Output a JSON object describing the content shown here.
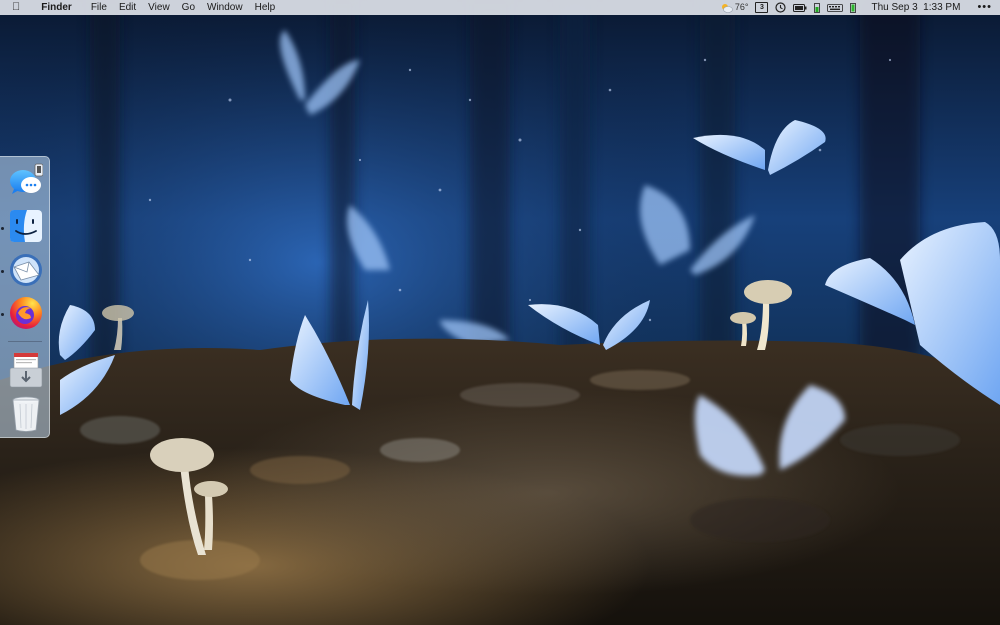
{
  "menubar": {
    "apple_icon": "apple-logo-icon",
    "app_name": "Finder",
    "menus": [
      "File",
      "Edit",
      "View",
      "Go",
      "Window",
      "Help"
    ],
    "weather": {
      "icon": "partly-cloudy-icon",
      "temperature": "76°"
    },
    "calendar_badge": "3",
    "clock": "Thu Sep 3  1:33 PM",
    "status_icons": [
      "weather-icon",
      "calendar-icon",
      "time-machine-icon",
      "battery-icon",
      "battery-level-icon",
      "keyboard-icon",
      "battery-green-icon",
      "more-icon"
    ]
  },
  "dock": {
    "items": [
      {
        "name": "messages",
        "icon": "messages-icon",
        "running": false
      },
      {
        "name": "finder",
        "icon": "finder-icon",
        "running": true
      },
      {
        "name": "mail",
        "icon": "mail-icon",
        "running": true
      },
      {
        "name": "firefox",
        "icon": "firefox-icon",
        "running": true
      },
      {
        "name": "downloads",
        "icon": "downloads-stack-icon",
        "running": false
      },
      {
        "name": "trash",
        "icon": "trash-icon",
        "running": false
      }
    ]
  },
  "wallpaper": {
    "description_icon": "wallpaper-blue-butterflies-mushrooms",
    "colors": {
      "sky_top": "#0d1f3c",
      "sky_mid": "#1d4c8a",
      "ground_dark": "#1b1712",
      "ground_light": "#8a6c45",
      "butterfly": "#b9d6ff"
    }
  }
}
